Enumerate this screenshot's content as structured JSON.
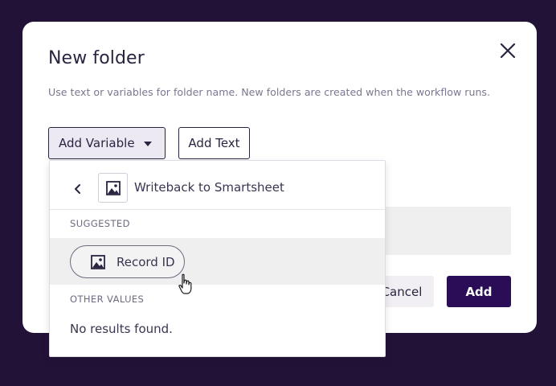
{
  "dialog": {
    "title": "New folder",
    "description": "Use text or variables for folder name. New folders are created when the workflow runs.",
    "add_variable_label": "Add Variable",
    "add_text_label": "Add Text",
    "cancel_label": "Cancel",
    "add_label": "Add",
    "close_icon": "close-icon"
  },
  "dropdown": {
    "source_label": "Writeback to Smartsheet",
    "suggested_heading": "SUGGESTED",
    "suggested_items": [
      {
        "label": "Record ID",
        "icon": "image-icon"
      }
    ],
    "other_heading": "OTHER VALUES",
    "empty_text": "No results found."
  },
  "colors": {
    "backdrop": "#231238",
    "primary": "#2b0d57",
    "text": "#2a2440"
  }
}
